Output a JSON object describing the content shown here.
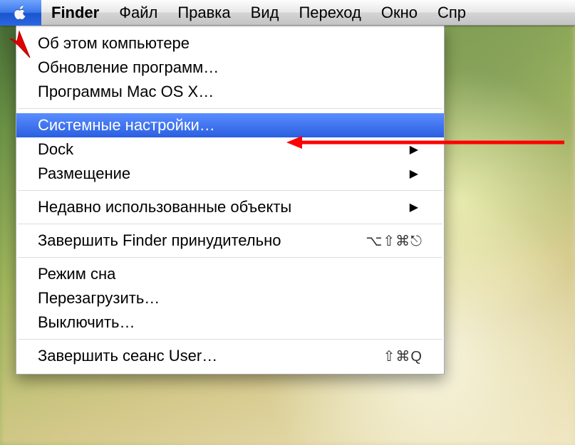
{
  "menubar": {
    "app": "Finder",
    "items": [
      "Файл",
      "Правка",
      "Вид",
      "Переход",
      "Окно",
      "Спр"
    ]
  },
  "apple_menu": {
    "items": [
      {
        "label": "Об этом компьютере",
        "type": "item"
      },
      {
        "label": "Обновление программ…",
        "type": "item"
      },
      {
        "label": "Программы Mac OS X…",
        "type": "item"
      },
      {
        "type": "separator"
      },
      {
        "label": "Системные настройки…",
        "type": "item",
        "highlighted": true
      },
      {
        "label": "Dock",
        "type": "submenu"
      },
      {
        "label": "Размещение",
        "type": "submenu"
      },
      {
        "type": "separator"
      },
      {
        "label": "Недавно использованные объекты",
        "type": "submenu"
      },
      {
        "type": "separator"
      },
      {
        "label": "Завершить Finder принудительно",
        "type": "item",
        "shortcut": "⌥⇧⌘⎋"
      },
      {
        "type": "separator"
      },
      {
        "label": "Режим сна",
        "type": "item"
      },
      {
        "label": "Перезагрузить…",
        "type": "item"
      },
      {
        "label": "Выключить…",
        "type": "item"
      },
      {
        "type": "separator"
      },
      {
        "label": "Завершить сеанс User…",
        "type": "item",
        "shortcut": "⇧⌘Q"
      }
    ]
  }
}
